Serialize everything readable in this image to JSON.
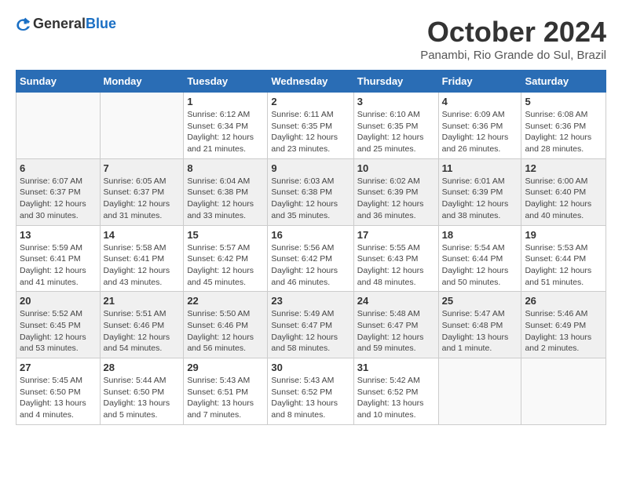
{
  "header": {
    "logo_general": "General",
    "logo_blue": "Blue",
    "month_title": "October 2024",
    "location": "Panambi, Rio Grande do Sul, Brazil"
  },
  "days_of_week": [
    "Sunday",
    "Monday",
    "Tuesday",
    "Wednesday",
    "Thursday",
    "Friday",
    "Saturday"
  ],
  "weeks": [
    [
      {
        "day": "",
        "info": ""
      },
      {
        "day": "",
        "info": ""
      },
      {
        "day": "1",
        "sunrise": "6:12 AM",
        "sunset": "6:34 PM",
        "daylight": "12 hours and 21 minutes."
      },
      {
        "day": "2",
        "sunrise": "6:11 AM",
        "sunset": "6:35 PM",
        "daylight": "12 hours and 23 minutes."
      },
      {
        "day": "3",
        "sunrise": "6:10 AM",
        "sunset": "6:35 PM",
        "daylight": "12 hours and 25 minutes."
      },
      {
        "day": "4",
        "sunrise": "6:09 AM",
        "sunset": "6:36 PM",
        "daylight": "12 hours and 26 minutes."
      },
      {
        "day": "5",
        "sunrise": "6:08 AM",
        "sunset": "6:36 PM",
        "daylight": "12 hours and 28 minutes."
      }
    ],
    [
      {
        "day": "6",
        "sunrise": "6:07 AM",
        "sunset": "6:37 PM",
        "daylight": "12 hours and 30 minutes."
      },
      {
        "day": "7",
        "sunrise": "6:05 AM",
        "sunset": "6:37 PM",
        "daylight": "12 hours and 31 minutes."
      },
      {
        "day": "8",
        "sunrise": "6:04 AM",
        "sunset": "6:38 PM",
        "daylight": "12 hours and 33 minutes."
      },
      {
        "day": "9",
        "sunrise": "6:03 AM",
        "sunset": "6:38 PM",
        "daylight": "12 hours and 35 minutes."
      },
      {
        "day": "10",
        "sunrise": "6:02 AM",
        "sunset": "6:39 PM",
        "daylight": "12 hours and 36 minutes."
      },
      {
        "day": "11",
        "sunrise": "6:01 AM",
        "sunset": "6:39 PM",
        "daylight": "12 hours and 38 minutes."
      },
      {
        "day": "12",
        "sunrise": "6:00 AM",
        "sunset": "6:40 PM",
        "daylight": "12 hours and 40 minutes."
      }
    ],
    [
      {
        "day": "13",
        "sunrise": "5:59 AM",
        "sunset": "6:41 PM",
        "daylight": "12 hours and 41 minutes."
      },
      {
        "day": "14",
        "sunrise": "5:58 AM",
        "sunset": "6:41 PM",
        "daylight": "12 hours and 43 minutes."
      },
      {
        "day": "15",
        "sunrise": "5:57 AM",
        "sunset": "6:42 PM",
        "daylight": "12 hours and 45 minutes."
      },
      {
        "day": "16",
        "sunrise": "5:56 AM",
        "sunset": "6:42 PM",
        "daylight": "12 hours and 46 minutes."
      },
      {
        "day": "17",
        "sunrise": "5:55 AM",
        "sunset": "6:43 PM",
        "daylight": "12 hours and 48 minutes."
      },
      {
        "day": "18",
        "sunrise": "5:54 AM",
        "sunset": "6:44 PM",
        "daylight": "12 hours and 50 minutes."
      },
      {
        "day": "19",
        "sunrise": "5:53 AM",
        "sunset": "6:44 PM",
        "daylight": "12 hours and 51 minutes."
      }
    ],
    [
      {
        "day": "20",
        "sunrise": "5:52 AM",
        "sunset": "6:45 PM",
        "daylight": "12 hours and 53 minutes."
      },
      {
        "day": "21",
        "sunrise": "5:51 AM",
        "sunset": "6:46 PM",
        "daylight": "12 hours and 54 minutes."
      },
      {
        "day": "22",
        "sunrise": "5:50 AM",
        "sunset": "6:46 PM",
        "daylight": "12 hours and 56 minutes."
      },
      {
        "day": "23",
        "sunrise": "5:49 AM",
        "sunset": "6:47 PM",
        "daylight": "12 hours and 58 minutes."
      },
      {
        "day": "24",
        "sunrise": "5:48 AM",
        "sunset": "6:47 PM",
        "daylight": "12 hours and 59 minutes."
      },
      {
        "day": "25",
        "sunrise": "5:47 AM",
        "sunset": "6:48 PM",
        "daylight": "13 hours and 1 minute."
      },
      {
        "day": "26",
        "sunrise": "5:46 AM",
        "sunset": "6:49 PM",
        "daylight": "13 hours and 2 minutes."
      }
    ],
    [
      {
        "day": "27",
        "sunrise": "5:45 AM",
        "sunset": "6:50 PM",
        "daylight": "13 hours and 4 minutes."
      },
      {
        "day": "28",
        "sunrise": "5:44 AM",
        "sunset": "6:50 PM",
        "daylight": "13 hours and 5 minutes."
      },
      {
        "day": "29",
        "sunrise": "5:43 AM",
        "sunset": "6:51 PM",
        "daylight": "13 hours and 7 minutes."
      },
      {
        "day": "30",
        "sunrise": "5:43 AM",
        "sunset": "6:52 PM",
        "daylight": "13 hours and 8 minutes."
      },
      {
        "day": "31",
        "sunrise": "5:42 AM",
        "sunset": "6:52 PM",
        "daylight": "13 hours and 10 minutes."
      },
      {
        "day": "",
        "info": ""
      },
      {
        "day": "",
        "info": ""
      }
    ]
  ]
}
